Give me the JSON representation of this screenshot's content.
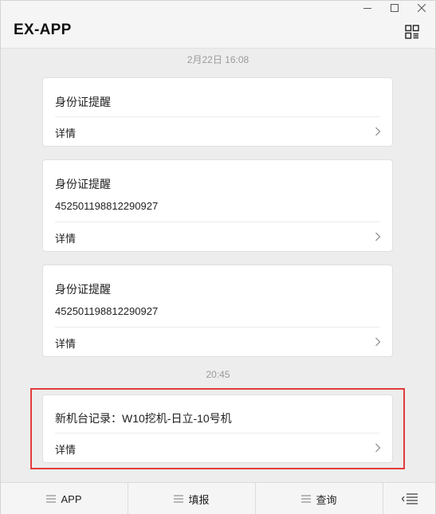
{
  "window": {
    "title": "EX-APP",
    "controls": [
      "minimize-icon",
      "maximize-icon",
      "close-icon"
    ],
    "menu_icon": "grid-menu-icon"
  },
  "messages": {
    "groups": [
      {
        "timestamp": "2月22日 16:08",
        "cards": [
          {
            "title": "身份证提醒",
            "subtitle": "",
            "detail_label": "详情"
          },
          {
            "title": "身份证提醒",
            "subtitle": "452501198812290927",
            "detail_label": "详情"
          },
          {
            "title": "身份证提醒",
            "subtitle": "452501198812290927",
            "detail_label": "详情"
          }
        ]
      },
      {
        "timestamp": "20:45",
        "cards": [
          {
            "title": "新机台记录：W10挖机-日立-10号机",
            "subtitle": "",
            "detail_label": "详情",
            "highlighted": true
          }
        ]
      }
    ]
  },
  "bottom_bar": {
    "tabs": [
      {
        "label": "APP",
        "icon": "menu-lines-icon"
      },
      {
        "label": "填报",
        "icon": "menu-lines-icon"
      },
      {
        "label": "查询",
        "icon": "menu-lines-icon"
      },
      {
        "label": "",
        "icon": "keyboard-toggle-icon"
      }
    ]
  },
  "colors": {
    "highlight_border": "#e23c3c",
    "background": "#ededed",
    "card": "#ffffff"
  }
}
